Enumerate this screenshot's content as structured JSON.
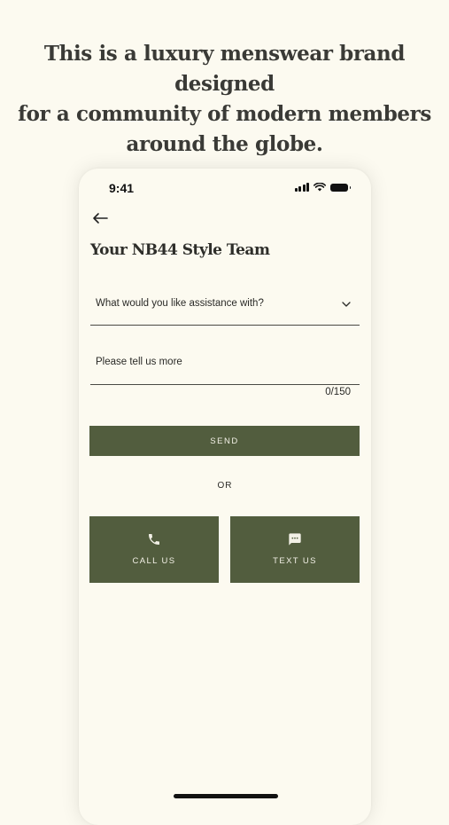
{
  "headline": {
    "line1": "This is a luxury menswear brand designed",
    "line2": "for a community of modern members",
    "line3": "around the globe."
  },
  "status_bar": {
    "time": "9:41"
  },
  "screen": {
    "title": "Your NB44 Style Team",
    "assistance_select": {
      "placeholder": "What would you like assistance with?"
    },
    "message": {
      "placeholder": "Please tell us more",
      "counter": "0/150"
    },
    "send_label": "SEND",
    "or_label": "OR",
    "call_label": "CALL US",
    "text_label": "TEXT US"
  },
  "colors": {
    "background": "#fcfaf0",
    "button": "#525d3e",
    "button_text": "#f2f0e6"
  },
  "icons": [
    "back-arrow-icon",
    "chevron-down-icon",
    "phone-icon",
    "chat-icon",
    "signal-icon",
    "wifi-icon",
    "battery-icon"
  ]
}
